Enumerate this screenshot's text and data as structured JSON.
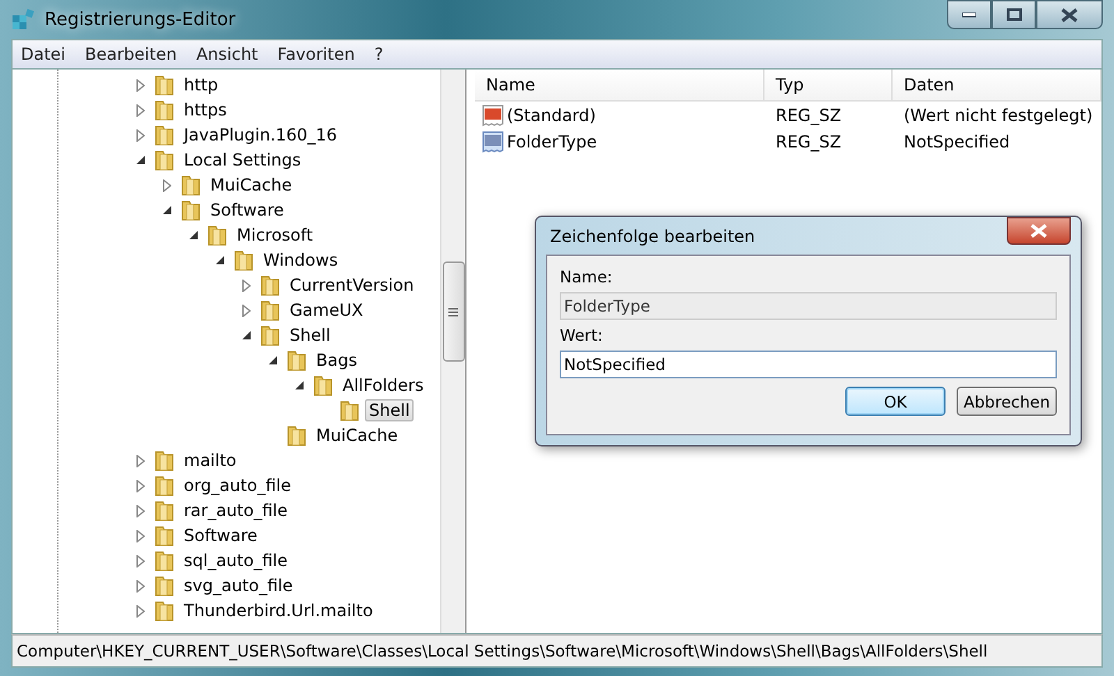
{
  "window": {
    "title": "Registrierungs-Editor"
  },
  "menu": [
    "Datei",
    "Bearbeiten",
    "Ansicht",
    "Favoriten",
    "?"
  ],
  "tree": [
    {
      "label": "http",
      "expanded": false,
      "selected": false
    },
    {
      "label": "https",
      "expanded": false,
      "selected": false
    },
    {
      "label": "JavaPlugin.160_16",
      "expanded": false,
      "selected": false
    },
    {
      "label": "Local Settings",
      "expanded": true,
      "selected": false,
      "children": [
        {
          "label": "MuiCache",
          "expanded": false,
          "selected": false
        },
        {
          "label": "Software",
          "expanded": true,
          "selected": false,
          "children": [
            {
              "label": "Microsoft",
              "expanded": true,
              "selected": false,
              "children": [
                {
                  "label": "Windows",
                  "expanded": true,
                  "selected": false,
                  "children": [
                    {
                      "label": "CurrentVersion",
                      "expanded": false,
                      "selected": false
                    },
                    {
                      "label": "GameUX",
                      "expanded": false,
                      "selected": false
                    },
                    {
                      "label": "Shell",
                      "expanded": true,
                      "selected": false,
                      "children": [
                        {
                          "label": "Bags",
                          "expanded": true,
                          "selected": false,
                          "children": [
                            {
                              "label": "AllFolders",
                              "expanded": true,
                              "selected": false,
                              "children": [
                                {
                                  "label": "Shell",
                                  "selected": true
                                }
                              ]
                            }
                          ]
                        },
                        {
                          "label": "MuiCache",
                          "selected": false
                        }
                      ]
                    }
                  ]
                }
              ]
            }
          ]
        }
      ]
    },
    {
      "label": "mailto",
      "expanded": false,
      "selected": false
    },
    {
      "label": "org_auto_file",
      "expanded": false,
      "selected": false
    },
    {
      "label": "rar_auto_file",
      "expanded": false,
      "selected": false
    },
    {
      "label": "Software",
      "expanded": false,
      "selected": false
    },
    {
      "label": "sql_auto_file",
      "expanded": false,
      "selected": false
    },
    {
      "label": "svg_auto_file",
      "expanded": false,
      "selected": false
    },
    {
      "label": "Thunderbird.Url.mailto",
      "expanded": false,
      "selected": false
    }
  ],
  "table": {
    "columns": [
      "Name",
      "Typ",
      "Daten"
    ],
    "rows": [
      {
        "kind": "default",
        "name": "(Standard)",
        "type": "REG_SZ",
        "data": "(Wert nicht festgelegt)"
      },
      {
        "kind": "string",
        "name": "FolderType",
        "type": "REG_SZ",
        "data": "NotSpecified"
      }
    ]
  },
  "dialog": {
    "title": "Zeichenfolge bearbeiten",
    "name_label": "Name:",
    "name_value": "FolderType",
    "value_label": "Wert:",
    "value": "NotSpecified",
    "buttons": [
      {
        "label": "OK",
        "default": true
      },
      {
        "label": "Abbrechen",
        "default": false
      }
    ]
  },
  "status_bar": "Computer\\HKEY_CURRENT_USER\\Software\\Classes\\Local Settings\\Software\\Microsoft\\Windows\\Shell\\Bags\\AllFolders\\Shell"
}
